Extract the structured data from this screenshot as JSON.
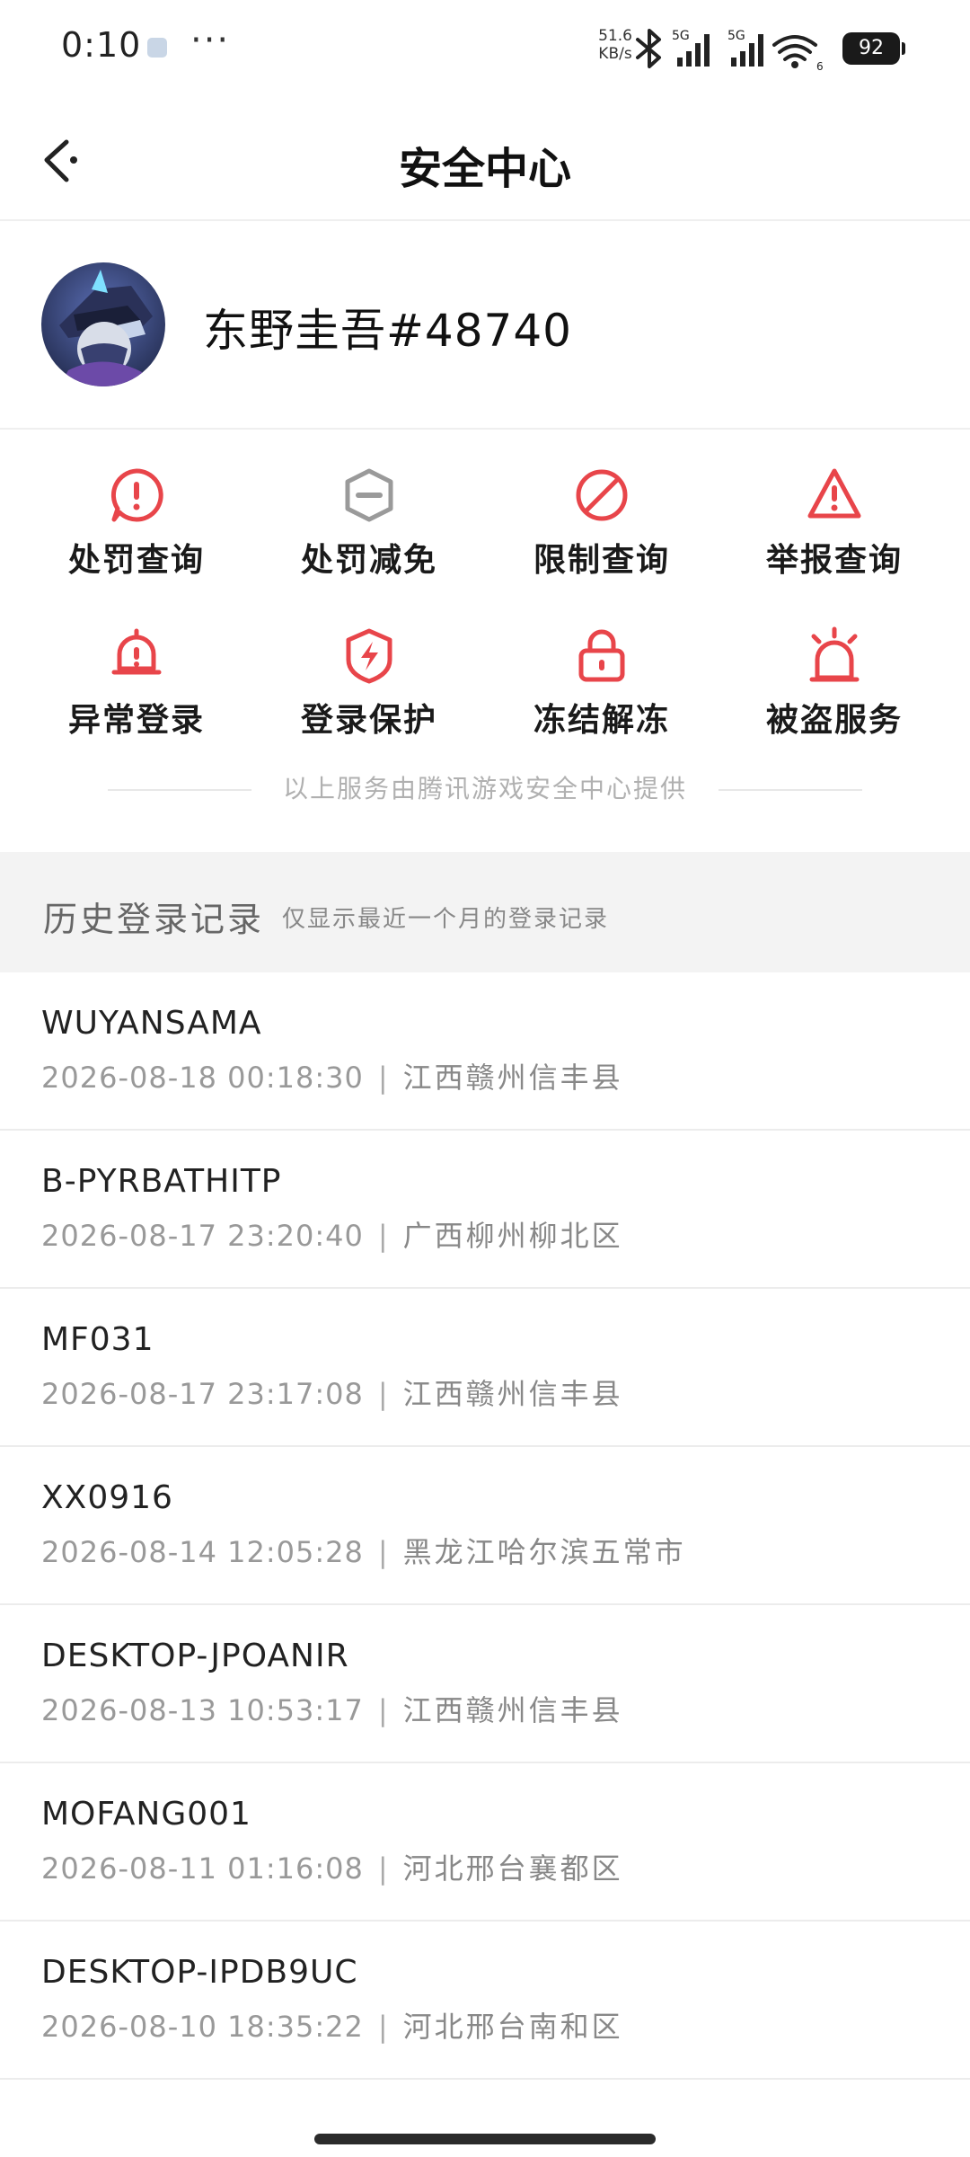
{
  "status_bar": {
    "time": "0:10",
    "more": "···",
    "net_speed": "51.6",
    "net_unit": "KB/s",
    "sim1": "5G",
    "sim2": "5G",
    "wifi_sub": "6",
    "battery": "92"
  },
  "header": {
    "title": "安全中心",
    "back_icon": "back-arrow-icon"
  },
  "profile": {
    "username": "东野圭吾#48740",
    "avatar_icon": "game-character-avatar"
  },
  "services": [
    {
      "label": "处罚查询",
      "icon": "exclamation-bubble-icon"
    },
    {
      "label": "处罚减免",
      "icon": "reduce-badge-icon"
    },
    {
      "label": "限制查询",
      "icon": "prohibited-icon"
    },
    {
      "label": "举报查询",
      "icon": "warning-triangle-icon"
    },
    {
      "label": "异常登录",
      "icon": "alarm-bell-icon"
    },
    {
      "label": "登录保护",
      "icon": "shield-bolt-icon"
    },
    {
      "label": "冻结解冻",
      "icon": "lock-icon"
    },
    {
      "label": "被盗服务",
      "icon": "siren-icon"
    }
  ],
  "provider_note": "以上服务由腾讯游戏安全中心提供",
  "history": {
    "title": "历史登录记录",
    "subtitle": "仅显示最近一个月的登录记录"
  },
  "logins": [
    {
      "device": "WUYANSAMA",
      "time": "2026-08-18 00:18:30",
      "location": "江西赣州信丰县"
    },
    {
      "device": "B-PYRBATHITP",
      "time": "2026-08-17 23:20:40",
      "location": "广西柳州柳北区"
    },
    {
      "device": "MF031",
      "time": "2026-08-17 23:17:08",
      "location": "江西赣州信丰县"
    },
    {
      "device": "XX0916",
      "time": "2026-08-14 12:05:28",
      "location": "黑龙江哈尔滨五常市"
    },
    {
      "device": "DESKTOP-JPOANIR",
      "time": "2026-08-13 10:53:17",
      "location": "江西赣州信丰县"
    },
    {
      "device": "MOFANG001",
      "time": "2026-08-11 01:16:08",
      "location": "河北邢台襄都区"
    },
    {
      "device": "DESKTOP-IPDB9UC",
      "time": "2026-08-10 18:35:22",
      "location": "河北邢台南和区"
    }
  ],
  "colors": {
    "accent_red": "#e8454a",
    "icon_gray": "#9a9a9a",
    "section_bg": "#f3f3f3"
  }
}
